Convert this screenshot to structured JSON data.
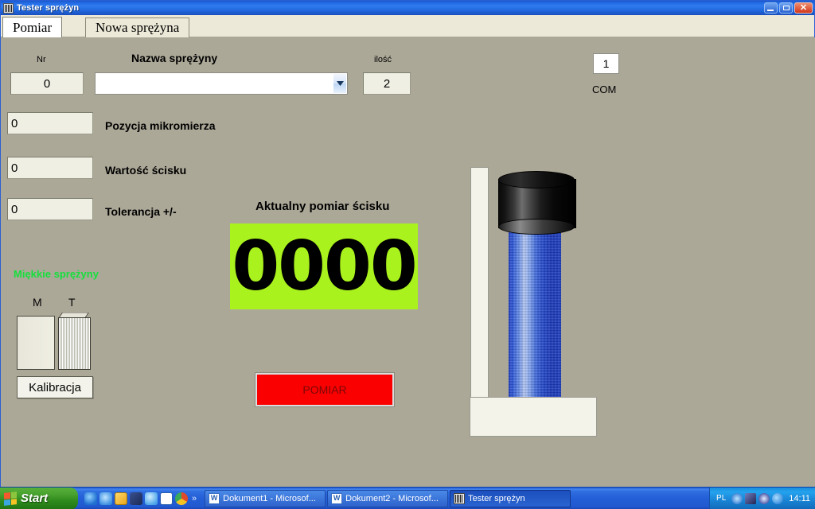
{
  "window": {
    "title": "Tester sprężyn",
    "icon": "app-icon",
    "buttons": {
      "minimize": "minimize-button",
      "maximize": "restore-button",
      "close": "close-button"
    }
  },
  "tabs": [
    {
      "label": "Pomiar",
      "active": true
    },
    {
      "label": "Nowa sprężyna",
      "active": false
    }
  ],
  "form": {
    "nr_label": "Nr",
    "nr_value": "0",
    "name_label": "Nazwa sprężyny",
    "name_value": "",
    "name_placeholder": "",
    "qty_label": "ilość",
    "qty_value": "2",
    "micrometer_label": "Pozycja mikromierza",
    "micrometer_value": "0",
    "force_label": "Wartość ścisku",
    "force_value": "0",
    "tolerance_label": "Tolerancja +/-",
    "tolerance_value": "0"
  },
  "com": {
    "value": "1",
    "label": "COM"
  },
  "measurement": {
    "title": "Aktualny pomiar ścisku",
    "value": "0000",
    "display_bg": "#aaf21e",
    "button_label": "POMIAR",
    "button_bg": "#fb0000"
  },
  "calibration": {
    "status_text": "Miękkie sprężyny",
    "status_color": "#14e03c",
    "label_m": "M",
    "label_t": "T",
    "button_label": "Kalibracja"
  },
  "taskbar": {
    "start_label": "Start",
    "quicklaunch": [
      {
        "name": "internet-explorer-icon",
        "color": "#1e6fd0"
      },
      {
        "name": "browser-icon",
        "color": "#3a8fe0"
      },
      {
        "name": "media-player-icon",
        "color": "#e8a61a"
      },
      {
        "name": "winamp-icon",
        "color": "#1b2a55"
      },
      {
        "name": "globe-icon",
        "color": "#4aa3e8"
      },
      {
        "name": "word-icon",
        "color": "#2a5fb0"
      },
      {
        "name": "chrome-icon",
        "color": "#e04a2a"
      }
    ],
    "chevrons": "»",
    "tasks": [
      {
        "label": "Dokument1 - Microsof...",
        "icon": "word-icon",
        "active": false
      },
      {
        "label": "Dokument2 - Microsof...",
        "icon": "word-icon",
        "active": false
      },
      {
        "label": "Tester sprężyn",
        "icon": "app-icon",
        "active": true
      }
    ],
    "tray": {
      "language": "PL",
      "icons": [
        {
          "name": "back-arrow-icon",
          "color": "#2f7ad0"
        },
        {
          "name": "network-icon",
          "color": "#3b3b6b"
        },
        {
          "name": "volume-icon",
          "color": "#5d6ebf"
        },
        {
          "name": "messenger-icon",
          "color": "#2e86d8"
        }
      ],
      "clock": "14:11"
    }
  }
}
